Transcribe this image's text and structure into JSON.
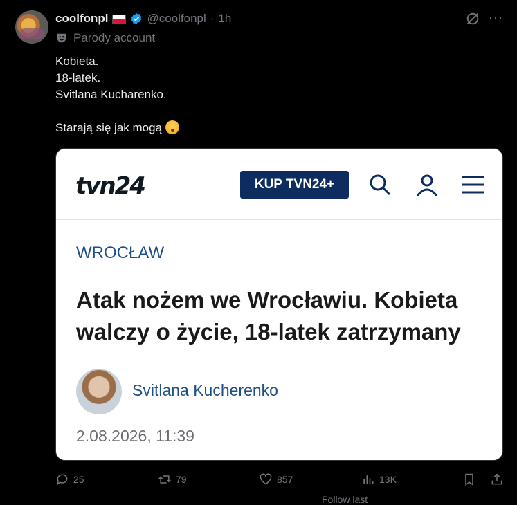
{
  "tweet": {
    "name": "coolfonpl",
    "handle": "@coolfonpl",
    "separator": "·",
    "time": "1h",
    "parody_label": "Parody account",
    "text": "Kobieta.\n18-latek.\nSvitlana Kucharenko.\n\nStarają się jak mogą",
    "more": "···"
  },
  "card": {
    "logo": "tvn24",
    "kup_label": "KUP TVN24+",
    "category": "WROCŁAW",
    "headline": "Atak nożem we Wrocławiu. Kobieta walczy o życie, 18-latek zatrzymany",
    "author": "Svitlana Kucherenko",
    "date": "2.08.2026, 11:39"
  },
  "actions": {
    "reply_count": "25",
    "repost_count": "79",
    "like_count": "857",
    "views_count": "13K"
  },
  "footer_partial": "Follow last"
}
